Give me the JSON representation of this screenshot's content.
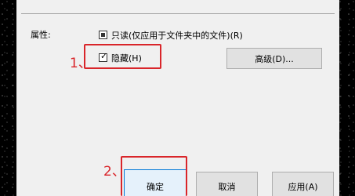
{
  "dialog": {
    "attributes_label": "属性:",
    "readonly_checkbox_label": "只读(仅应用于文件夹中的文件)(R)",
    "hidden_checkbox_label": "隐藏(H)",
    "advanced_button": "高级(D)...",
    "ok_button": "确定",
    "cancel_button": "取消",
    "apply_button": "应用(A)"
  },
  "annotations": {
    "step1": "1、",
    "step2": "2、",
    "highlight_color": "#d9252a"
  },
  "states": {
    "readonly": "indeterminate",
    "hidden": "checked"
  }
}
